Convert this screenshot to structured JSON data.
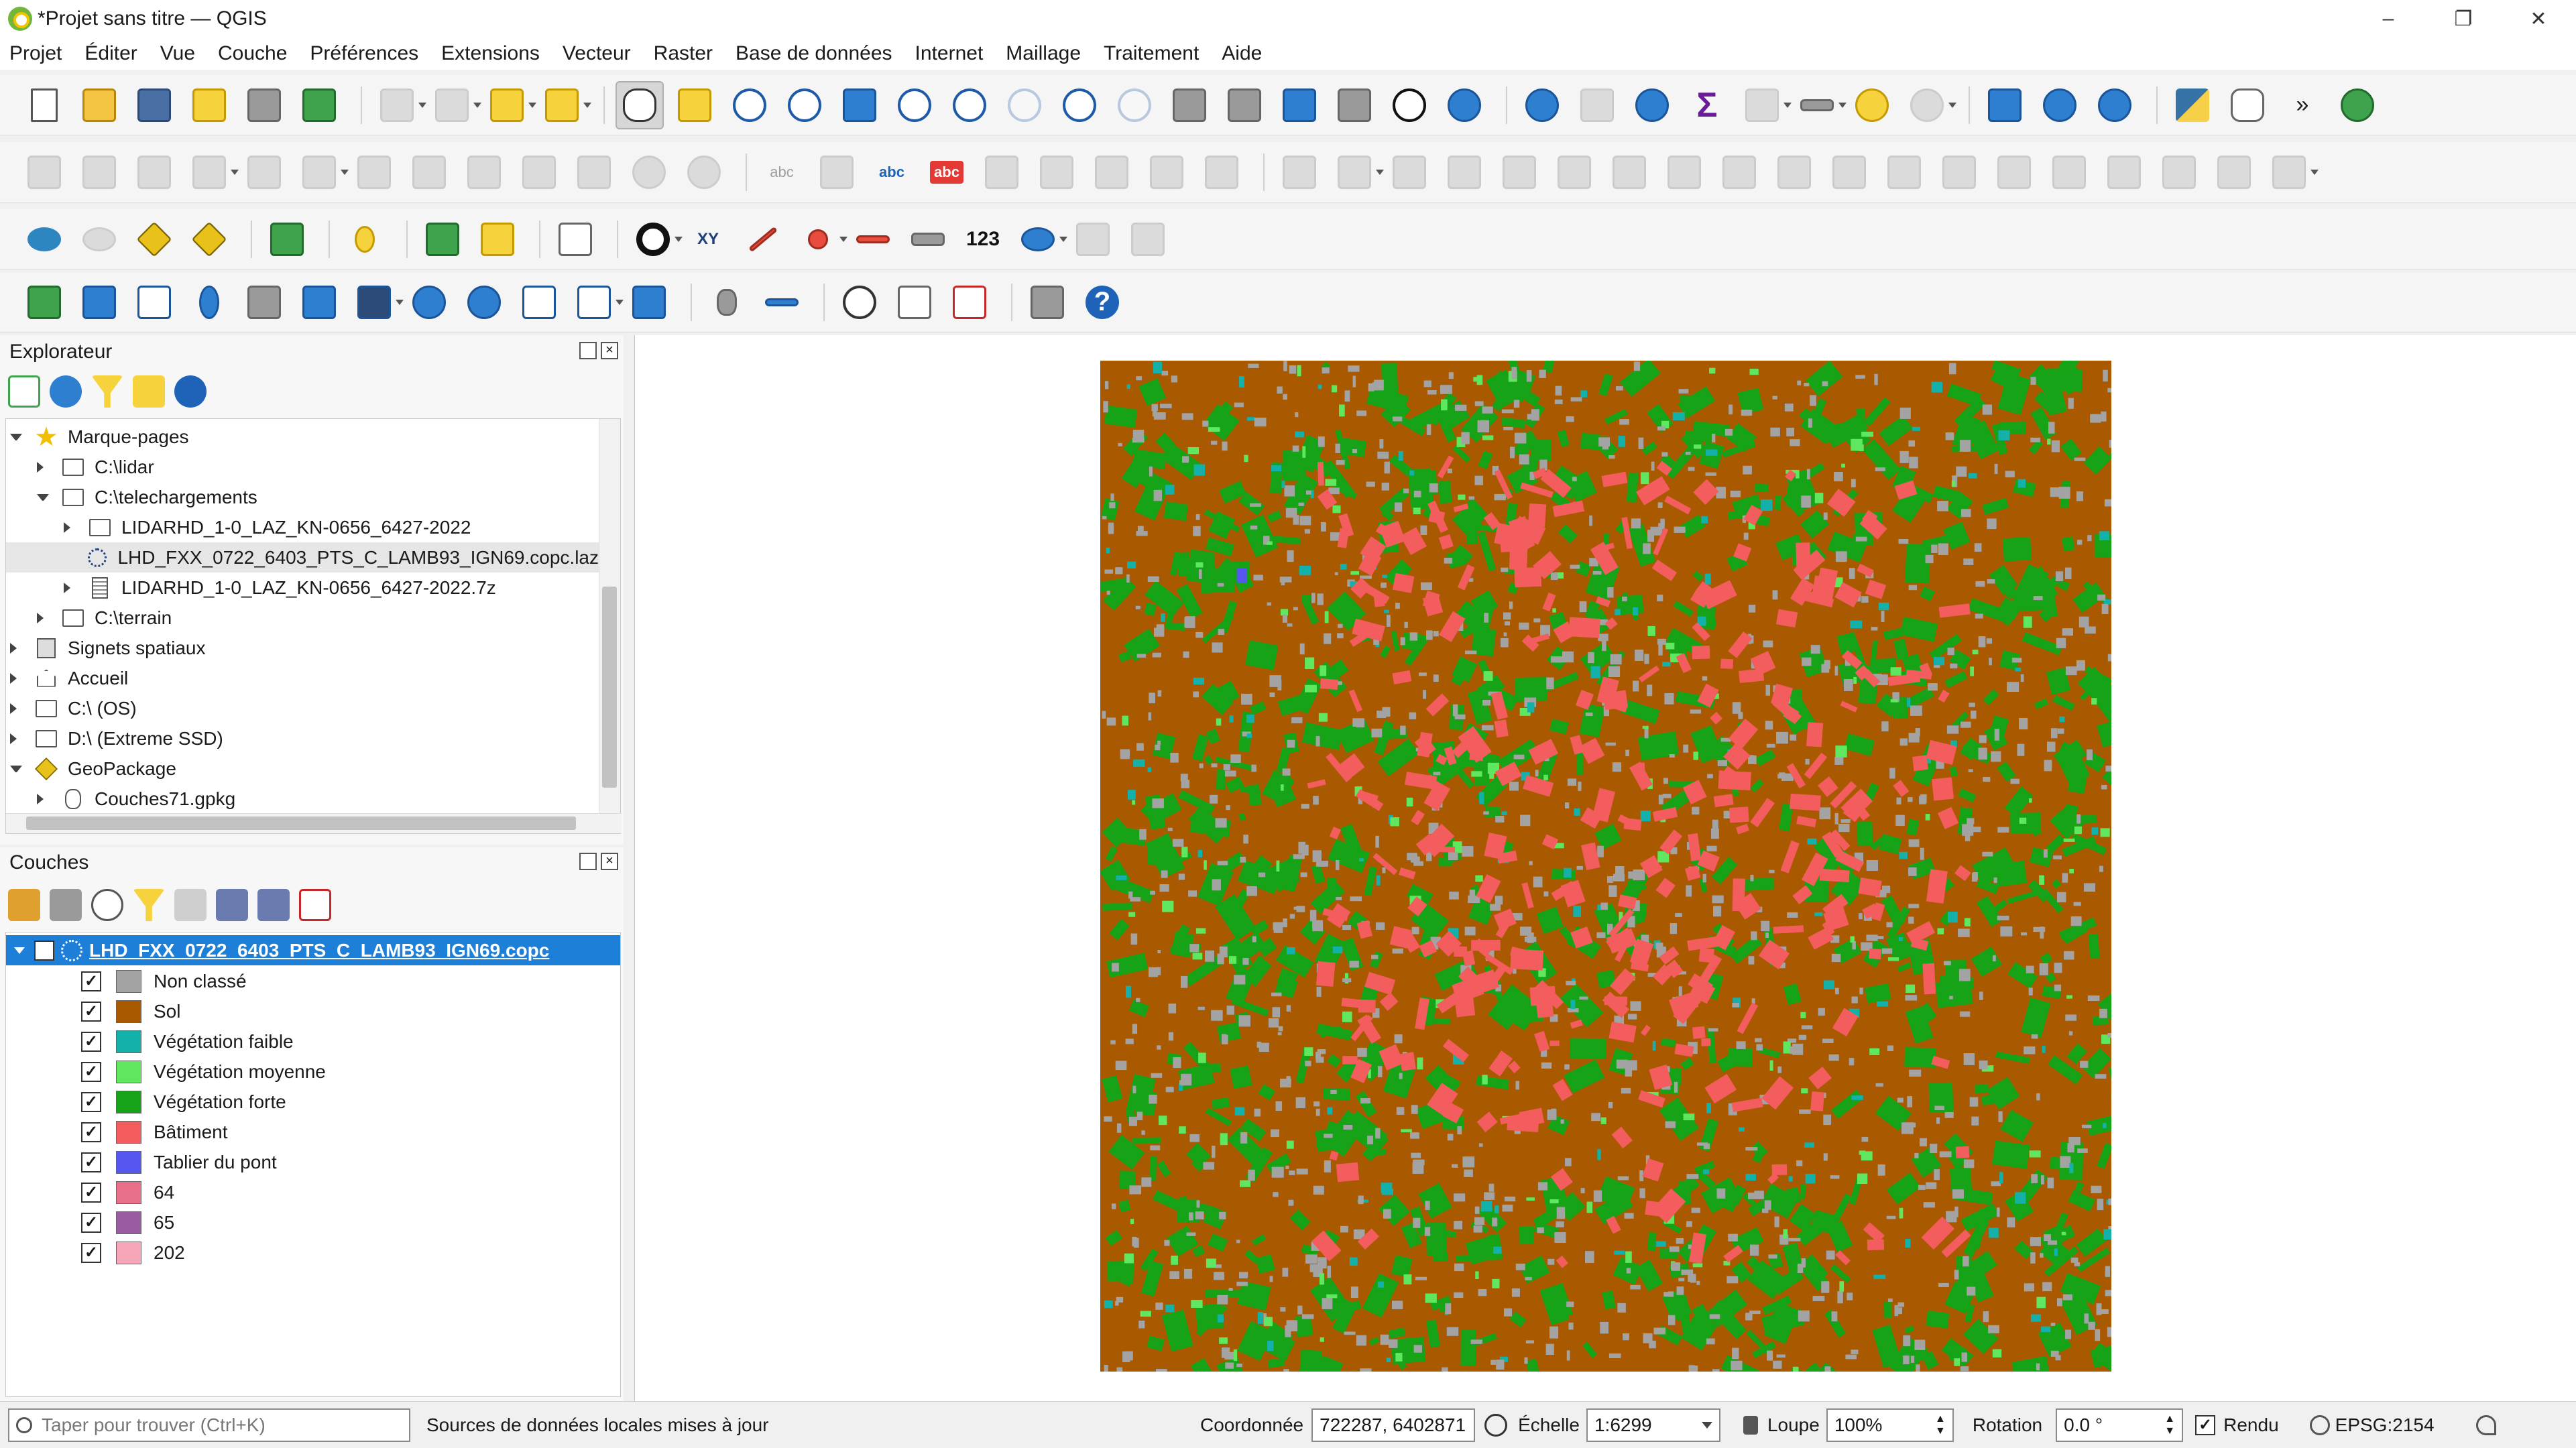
{
  "window": {
    "title": "*Projet sans titre — QGIS",
    "controls": [
      "–",
      "❐",
      "✕"
    ]
  },
  "menu": [
    "Projet",
    "Éditer",
    "Vue",
    "Couche",
    "Préférences",
    "Extensions",
    "Vecteur",
    "Raster",
    "Base de données",
    "Internet",
    "Maillage",
    "Traitement",
    "Aide"
  ],
  "toolbar_glyphs": {
    "label_abc": "abc",
    "xy": "XY",
    "num_123": "123",
    "sigma": "Σ",
    "help": "?",
    "more": "»"
  },
  "browser": {
    "title": "Explorateur",
    "items": [
      {
        "label": "Marque-pages",
        "icon": "star-icon",
        "depth": 0,
        "expanded": true
      },
      {
        "label": "C:\\lidar",
        "icon": "folder-icon",
        "depth": 1,
        "expanded": false
      },
      {
        "label": "C:\\telechargements",
        "icon": "folder-icon",
        "depth": 1,
        "expanded": true
      },
      {
        "label": "LIDARHD_1-0_LAZ_KN-0656_6427-2022",
        "icon": "folder-icon",
        "depth": 2,
        "expanded": false
      },
      {
        "label": "LHD_FXX_0722_6403_PTS_C_LAMB93_IGN69.copc.laz",
        "icon": "point-cloud-icon",
        "depth": 2,
        "expanded": null,
        "selected": true
      },
      {
        "label": "LIDARHD_1-0_LAZ_KN-0656_6427-2022.7z",
        "icon": "archive-icon",
        "depth": 2,
        "expanded": false
      },
      {
        "label": "C:\\terrain",
        "icon": "folder-icon",
        "depth": 1,
        "expanded": false
      },
      {
        "label": "Signets spatiaux",
        "icon": "spatial-bookmark-icon",
        "depth": 0,
        "expanded": false
      },
      {
        "label": "Accueil",
        "icon": "home-icon",
        "depth": 0,
        "expanded": false
      },
      {
        "label": "C:\\ (OS)",
        "icon": "drive-icon",
        "depth": 0,
        "expanded": false
      },
      {
        "label": "D:\\ (Extreme SSD)",
        "icon": "drive-icon",
        "depth": 0,
        "expanded": false
      },
      {
        "label": "GeoPackage",
        "icon": "geopackage-icon",
        "depth": 0,
        "expanded": true
      },
      {
        "label": "Couches71.gpkg",
        "icon": "database-icon",
        "depth": 1,
        "expanded": false
      }
    ]
  },
  "layers": {
    "title": "Couches",
    "layer_name": "LHD_FXX_0722_6403_PTS_C_LAMB93_IGN69.copc",
    "check": "✓",
    "classes": [
      {
        "label": "Non classé",
        "color": "#a3a3a3"
      },
      {
        "label": "Sol",
        "color": "#a95a00"
      },
      {
        "label": "Végétation faible",
        "color": "#14b1aa"
      },
      {
        "label": "Végétation moyenne",
        "color": "#5fe85f"
      },
      {
        "label": "Végétation forte",
        "color": "#17a317"
      },
      {
        "label": "Bâtiment",
        "color": "#f35d5d"
      },
      {
        "label": "Tablier du pont",
        "color": "#5656f0"
      },
      {
        "label": "64",
        "color": "#e8708a"
      },
      {
        "label": "65",
        "color": "#9b5ba3"
      },
      {
        "label": "202",
        "color": "#f5a6b8"
      }
    ]
  },
  "status": {
    "search_placeholder": "Taper pour trouver (Ctrl+K)",
    "message": "Sources de données locales mises à jour",
    "coord_label": "Coordonnée",
    "coord_value": "722287, 6402871",
    "scale_label": "Échelle",
    "scale_value": "1:6299",
    "magnifier_label": "Loupe",
    "magnifier_value": "100%",
    "rotation_label": "Rotation",
    "rotation_value": "0.0 °",
    "render_label": "Rendu",
    "crs": "EPSG:2154"
  }
}
